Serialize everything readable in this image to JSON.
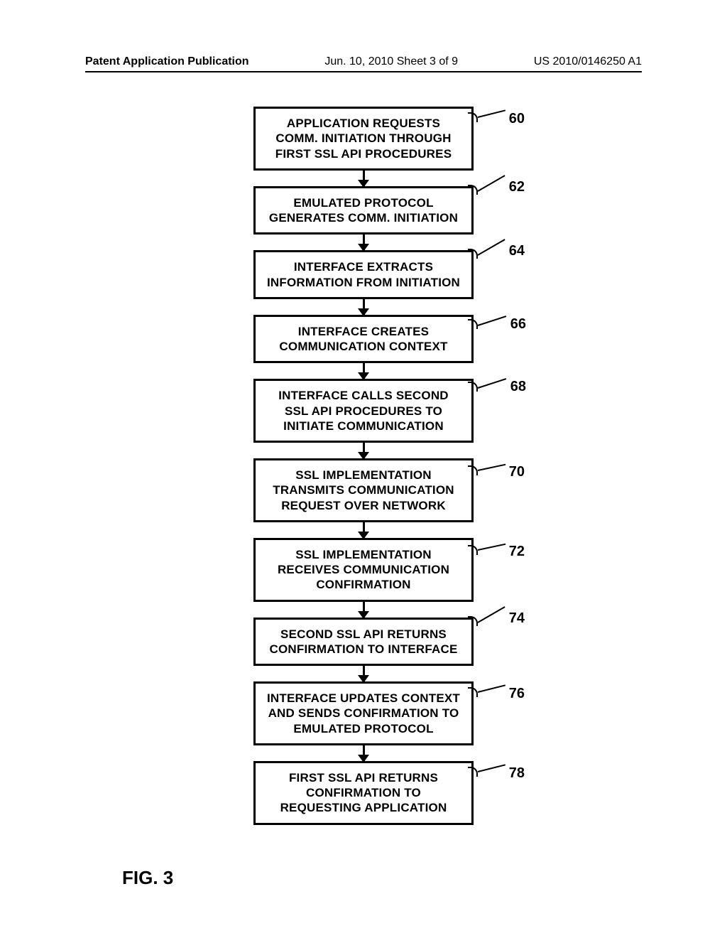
{
  "header": {
    "left": "Patent Application Publication",
    "center": "Jun. 10, 2010  Sheet 3 of 9",
    "right": "US 2010/0146250 A1"
  },
  "figure_label": "FIG. 3",
  "steps": [
    {
      "ref": "60",
      "text": "APPLICATION REQUESTS COMM. INITIATION THROUGH FIRST SSL API PROCEDURES"
    },
    {
      "ref": "62",
      "text": "EMULATED PROTOCOL GENERATES COMM. INITIATION"
    },
    {
      "ref": "64",
      "text": "INTERFACE EXTRACTS INFORMATION FROM INITIATION"
    },
    {
      "ref": "66",
      "text": "INTERFACE CREATES COMMUNICATION CONTEXT"
    },
    {
      "ref": "68",
      "text": "INTERFACE CALLS SECOND SSL API PROCEDURES TO INITIATE COMMUNICATION"
    },
    {
      "ref": "70",
      "text": "SSL IMPLEMENTATION TRANSMITS COMMUNICATION REQUEST OVER NETWORK"
    },
    {
      "ref": "72",
      "text": "SSL IMPLEMENTATION RECEIVES COMMUNICATION CONFIRMATION"
    },
    {
      "ref": "74",
      "text": "SECOND SSL API RETURNS CONFIRMATION TO INTERFACE"
    },
    {
      "ref": "76",
      "text": "INTERFACE UPDATES CONTEXT AND SENDS CONFIRMATION TO EMULATED PROTOCOL"
    },
    {
      "ref": "78",
      "text": "FIRST SSL API RETURNS CONFIRMATION TO REQUESTING APPLICATION"
    }
  ]
}
